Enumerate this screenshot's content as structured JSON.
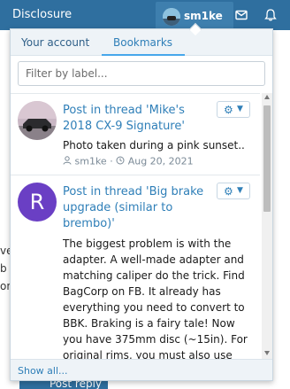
{
  "header": {
    "brand": "Disclosure",
    "username": "sm1ke",
    "icons": [
      "mail-icon",
      "bell-icon"
    ]
  },
  "background": {
    "fragments": [
      "ve",
      "b",
      "or",
      "on"
    ],
    "post_reply_label": "Post reply"
  },
  "popup": {
    "tabs": [
      {
        "label": "Your account",
        "active": false
      },
      {
        "label": "Bookmarks",
        "active": true
      }
    ],
    "filter_placeholder": "Filter by label...",
    "items": [
      {
        "title": "Post in thread 'Mike's 2018 CX-9 Signature'",
        "snippet": "Photo taken during a pink sunset..",
        "author": "sm1ke",
        "date": "Aug 20, 2021",
        "avatar": "photo"
      },
      {
        "title": "Post in thread 'Big brake upgrade (similar to brembo)'",
        "snippet": "The biggest problem is with the adapter. A well-made adapter and matching caliper do the trick. Find BagCorp on FB. It already has everything you need to convert to BBK. Braking is a fairy tale! Now you have 375mm disc (~15in). For original rims, you must also use distances...",
        "avatar_letter": "R",
        "avatar": "letter"
      }
    ],
    "footer_link": "Show all..."
  },
  "colors": {
    "topbar": "#2f6f9f",
    "link": "#2f7fb8",
    "tab_underline": "#47a7eb",
    "letter_avatar": "#6a3fc4"
  }
}
